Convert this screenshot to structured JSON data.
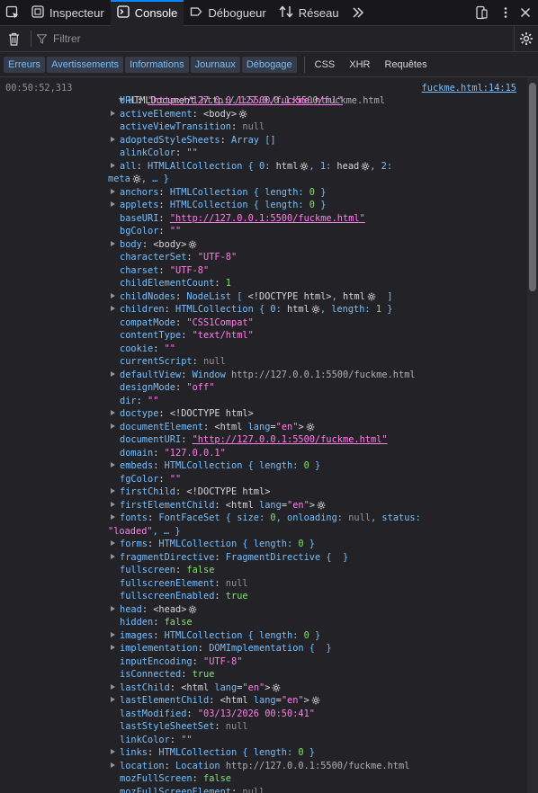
{
  "toolbar": {
    "inspector": "Inspecteur",
    "console": "Console",
    "debugger": "Débogueur",
    "network": "Réseau"
  },
  "filterbar": {
    "placeholder": "Filtrer"
  },
  "categories": {
    "errors": "Erreurs",
    "warnings": "Avertissements",
    "info": "Informations",
    "logs": "Journaux",
    "debug": "Débogage",
    "css": "CSS",
    "xhr": "XHR",
    "requests": "Requêtes"
  },
  "message": {
    "timestamp": "00:50:52,313",
    "location": "fuckme.html:14:15",
    "header_type": "HTMLDocument",
    "header_url": "http://127.0.0.1:5500/fuckme.html"
  },
  "lines": [
    {
      "t": "URL",
      "parts": [
        [
          "str-u",
          "\"http://127.0.0.1:5500/fuckme.html\""
        ]
      ]
    },
    {
      "t": "activeElement",
      "arrow": true,
      "parts": [
        [
          "tag",
          "<body>"
        ],
        [
          "gear",
          ""
        ]
      ]
    },
    {
      "t": "activeViewTransition",
      "parts": [
        [
          "null",
          "null"
        ]
      ]
    },
    {
      "t": "adoptedStyleSheets",
      "arrow": true,
      "parts": [
        [
          "obj",
          "Array []"
        ]
      ]
    },
    {
      "t": "alinkColor",
      "parts": [
        [
          "str",
          "\"\""
        ]
      ]
    },
    {
      "t": "all",
      "arrow": true,
      "parts": [
        [
          "obj",
          "HTMLAllCollection { 0: "
        ],
        [
          "tag",
          "html"
        ],
        [
          "gear",
          ""
        ],
        [
          "obj",
          ", 1: "
        ],
        [
          "tag",
          "head"
        ],
        [
          "gear",
          ""
        ],
        [
          "obj",
          ", 2:"
        ]
      ]
    },
    {
      "t": "",
      "cont": "meta",
      "parts": [
        [
          "gear",
          ""
        ],
        [
          "obj",
          ", … }"
        ]
      ]
    },
    {
      "t": "anchors",
      "arrow": true,
      "parts": [
        [
          "obj",
          "HTMLCollection { length: "
        ],
        [
          "num",
          "0"
        ],
        [
          "obj",
          " }"
        ]
      ]
    },
    {
      "t": "applets",
      "arrow": true,
      "parts": [
        [
          "obj",
          "HTMLCollection { length: "
        ],
        [
          "num",
          "0"
        ],
        [
          "obj",
          " }"
        ]
      ]
    },
    {
      "t": "baseURI",
      "parts": [
        [
          "str-u",
          "\"http://127.0.0.1:5500/fuckme.html\""
        ]
      ]
    },
    {
      "t": "bgColor",
      "parts": [
        [
          "str",
          "\"\""
        ]
      ]
    },
    {
      "t": "body",
      "arrow": true,
      "parts": [
        [
          "tag",
          "<body>"
        ],
        [
          "gear",
          ""
        ]
      ]
    },
    {
      "t": "characterSet",
      "parts": [
        [
          "str",
          "\"UTF-8\""
        ]
      ]
    },
    {
      "t": "charset",
      "parts": [
        [
          "str",
          "\"UTF-8\""
        ]
      ]
    },
    {
      "t": "childElementCount",
      "parts": [
        [
          "num",
          "1"
        ]
      ]
    },
    {
      "t": "childNodes",
      "arrow": true,
      "parts": [
        [
          "obj",
          "NodeList [ "
        ],
        [
          "tag",
          "<!DOCTYPE html>"
        ],
        [
          "obj",
          ", "
        ],
        [
          "tag",
          "html"
        ],
        [
          "gear",
          ""
        ],
        [
          "obj",
          "  ]"
        ]
      ]
    },
    {
      "t": "children",
      "arrow": true,
      "parts": [
        [
          "obj",
          "HTMLCollection { 0: "
        ],
        [
          "tag",
          "html"
        ],
        [
          "gear",
          ""
        ],
        [
          "obj",
          ", length: "
        ],
        [
          "num",
          "1"
        ],
        [
          "obj",
          " }"
        ]
      ]
    },
    {
      "t": "compatMode",
      "parts": [
        [
          "str",
          "\"CSS1Compat\""
        ]
      ]
    },
    {
      "t": "contentType",
      "parts": [
        [
          "str",
          "\"text/html\""
        ]
      ]
    },
    {
      "t": "cookie",
      "parts": [
        [
          "str",
          "\"\""
        ]
      ]
    },
    {
      "t": "currentScript",
      "parts": [
        [
          "null",
          "null"
        ]
      ]
    },
    {
      "t": "defaultView",
      "arrow": true,
      "parts": [
        [
          "obj",
          "Window "
        ],
        [
          "dim",
          "http://127.0.0.1:5500/fuckme.html"
        ]
      ]
    },
    {
      "t": "designMode",
      "parts": [
        [
          "str",
          "\"off\""
        ]
      ]
    },
    {
      "t": "dir",
      "parts": [
        [
          "str",
          "\"\""
        ]
      ]
    },
    {
      "t": "doctype",
      "arrow": true,
      "parts": [
        [
          "tag",
          "<!DOCTYPE html>"
        ]
      ]
    },
    {
      "t": "documentElement",
      "arrow": true,
      "parts": [
        [
          "tag",
          "<html "
        ],
        [
          "attr",
          "lang"
        ],
        [
          "tag",
          "="
        ],
        [
          "str",
          "\"en\""
        ],
        [
          "tag",
          ">"
        ],
        [
          "gear",
          ""
        ]
      ]
    },
    {
      "t": "documentURI",
      "parts": [
        [
          "str-u",
          "\"http://127.0.0.1:5500/fuckme.html\""
        ]
      ]
    },
    {
      "t": "domain",
      "parts": [
        [
          "str",
          "\"127.0.0.1\""
        ]
      ]
    },
    {
      "t": "embeds",
      "arrow": true,
      "parts": [
        [
          "obj",
          "HTMLCollection { length: "
        ],
        [
          "num",
          "0"
        ],
        [
          "obj",
          " }"
        ]
      ]
    },
    {
      "t": "fgColor",
      "parts": [
        [
          "str",
          "\"\""
        ]
      ]
    },
    {
      "t": "firstChild",
      "arrow": true,
      "parts": [
        [
          "tag",
          "<!DOCTYPE html>"
        ]
      ]
    },
    {
      "t": "firstElementChild",
      "arrow": true,
      "parts": [
        [
          "tag",
          "<html "
        ],
        [
          "attr",
          "lang"
        ],
        [
          "tag",
          "="
        ],
        [
          "str",
          "\"en\""
        ],
        [
          "tag",
          ">"
        ],
        [
          "gear",
          ""
        ]
      ]
    },
    {
      "t": "fonts",
      "arrow": true,
      "parts": [
        [
          "obj",
          "FontFaceSet { size: "
        ],
        [
          "num",
          "0"
        ],
        [
          "obj",
          ", onloading: "
        ],
        [
          "null",
          "null"
        ],
        [
          "obj",
          ", status:"
        ]
      ]
    },
    {
      "t": "",
      "cont": "",
      "parts": [
        [
          "str",
          "\"loaded\""
        ],
        [
          "obj",
          ", … }"
        ]
      ]
    },
    {
      "t": "forms",
      "arrow": true,
      "parts": [
        [
          "obj",
          "HTMLCollection { length: "
        ],
        [
          "num",
          "0"
        ],
        [
          "obj",
          " }"
        ]
      ]
    },
    {
      "t": "fragmentDirective",
      "arrow": true,
      "parts": [
        [
          "obj",
          "FragmentDirective {  }"
        ]
      ]
    },
    {
      "t": "fullscreen",
      "parts": [
        [
          "bool",
          "false"
        ]
      ]
    },
    {
      "t": "fullscreenElement",
      "parts": [
        [
          "null",
          "null"
        ]
      ]
    },
    {
      "t": "fullscreenEnabled",
      "parts": [
        [
          "bool",
          "true"
        ]
      ]
    },
    {
      "t": "head",
      "arrow": true,
      "parts": [
        [
          "tag",
          "<head>"
        ],
        [
          "gear",
          ""
        ]
      ]
    },
    {
      "t": "hidden",
      "parts": [
        [
          "bool",
          "false"
        ]
      ]
    },
    {
      "t": "images",
      "arrow": true,
      "parts": [
        [
          "obj",
          "HTMLCollection { length: "
        ],
        [
          "num",
          "0"
        ],
        [
          "obj",
          " }"
        ]
      ]
    },
    {
      "t": "implementation",
      "arrow": true,
      "parts": [
        [
          "obj",
          "DOMImplementation {  }"
        ]
      ]
    },
    {
      "t": "inputEncoding",
      "parts": [
        [
          "str",
          "\"UTF-8\""
        ]
      ]
    },
    {
      "t": "isConnected",
      "parts": [
        [
          "bool",
          "true"
        ]
      ]
    },
    {
      "t": "lastChild",
      "arrow": true,
      "parts": [
        [
          "tag",
          "<html "
        ],
        [
          "attr",
          "lang"
        ],
        [
          "tag",
          "="
        ],
        [
          "str",
          "\"en\""
        ],
        [
          "tag",
          ">"
        ],
        [
          "gear",
          ""
        ]
      ]
    },
    {
      "t": "lastElementChild",
      "arrow": true,
      "parts": [
        [
          "tag",
          "<html "
        ],
        [
          "attr",
          "lang"
        ],
        [
          "tag",
          "="
        ],
        [
          "str",
          "\"en\""
        ],
        [
          "tag",
          ">"
        ],
        [
          "gear",
          ""
        ]
      ]
    },
    {
      "t": "lastModified",
      "parts": [
        [
          "str",
          "\"03/13/2026 00:50:41\""
        ]
      ]
    },
    {
      "t": "lastStyleSheetSet",
      "parts": [
        [
          "null",
          "null"
        ]
      ]
    },
    {
      "t": "linkColor",
      "parts": [
        [
          "str",
          "\"\""
        ]
      ]
    },
    {
      "t": "links",
      "arrow": true,
      "parts": [
        [
          "obj",
          "HTMLCollection { length: "
        ],
        [
          "num",
          "0"
        ],
        [
          "obj",
          " }"
        ]
      ]
    },
    {
      "t": "location",
      "arrow": true,
      "parts": [
        [
          "obj",
          "Location "
        ],
        [
          "dim",
          "http://127.0.0.1:5500/fuckme.html"
        ]
      ]
    },
    {
      "t": "mozFullScreen",
      "parts": [
        [
          "bool",
          "false"
        ]
      ]
    },
    {
      "t": "mozFullScreenElement",
      "parts": [
        [
          "null",
          "null"
        ]
      ]
    }
  ]
}
